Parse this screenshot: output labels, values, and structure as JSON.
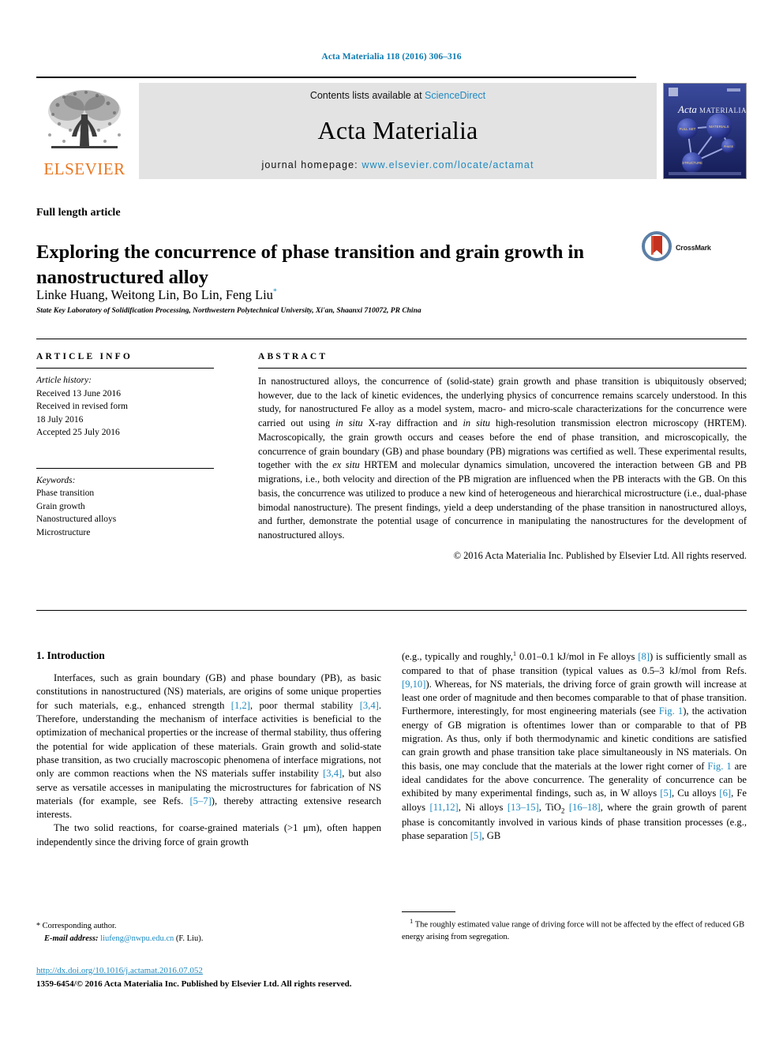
{
  "running_head": "Acta Materialia 118 (2016) 306–316",
  "masthead": {
    "publisher_name": "ELSEVIER",
    "publisher_logo_icon": "elsevier-tree-icon",
    "contents_prefix": "Contents lists available at",
    "contents_link": "ScienceDirect",
    "journal_title": "Acta Materialia",
    "homepage_prefix": "journal homepage:",
    "homepage_url": "www.elsevier.com/locate/actamat",
    "cover_title_italic": "Acta",
    "cover_title_rest": "MATERIALIA",
    "cover_icon": "journal-cover-thumbnail"
  },
  "article": {
    "type": "Full length article",
    "title": "Exploring the concurrence of phase transition and grain growth in nanostructured alloy",
    "authors": "Linke Huang, Weitong Lin, Bo Lin, Feng Liu",
    "corresponding_marker": "*",
    "affiliation": "State Key Laboratory of Solidification Processing, Northwestern Polytechnical University, Xi'an, Shaanxi 710072, PR China",
    "crossmark_label": "CrossMark",
    "crossmark_icon": "crossmark-icon"
  },
  "article_info": {
    "heading": "ARTICLE INFO",
    "history_label": "Article history:",
    "history": [
      "Received 13 June 2016",
      "Received in revised form",
      "18 July 2016",
      "Accepted 25 July 2016"
    ],
    "keywords_label": "Keywords:",
    "keywords": [
      "Phase transition",
      "Grain growth",
      "Nanostructured alloys",
      "Microstructure"
    ]
  },
  "abstract": {
    "heading": "ABSTRACT",
    "paragraph_1": "In nanostructured alloys, the concurrence of (solid-state) grain growth and phase transition is ubiquitously observed; however, due to the lack of kinetic evidences, the underlying physics of concurrence remains scarcely understood. In this study, for nanostructured Fe alloy as a model system, macro- and micro-scale characterizations for the concurrence were carried out using ",
    "italic_1": "in situ",
    "paragraph_2": " X-ray diffraction and ",
    "italic_2": "in situ",
    "paragraph_3": " high-resolution transmission electron microscopy (HRTEM). Macroscopically, the grain growth occurs and ceases before the end of phase transition, and microscopically, the concurrence of grain boundary (GB) and phase boundary (PB) migrations was certified as well. These experimental results, together with the ",
    "italic_3": "ex situ",
    "paragraph_4": " HRTEM and molecular dynamics simulation, uncovered the interaction between GB and PB migrations, i.e., both velocity and direction of the PB migration are influenced when the PB interacts with the GB. On this basis, the concurrence was utilized to produce a new kind of heterogeneous and hierarchical microstructure (i.e., dual-phase bimodal nanostructure). The present findings, yield a deep understanding of the phase transition in nanostructured alloys, and further, demonstrate the potential usage of concurrence in manipulating the nanostructures for the development of nanostructured alloys.",
    "copyright": "© 2016 Acta Materialia Inc. Published by Elsevier Ltd. All rights reserved."
  },
  "intro": {
    "heading": "1. Introduction",
    "left_para_1_a": "Interfaces, such as grain boundary (GB) and phase boundary (PB), as basic constitutions in nanostructured (NS) materials, are origins of some unique properties for such materials, e.g., enhanced strength ",
    "left_ref_1": "[1,2]",
    "left_para_1_b": ", poor thermal stability ",
    "left_ref_2": "[3,4]",
    "left_para_1_c": ". Therefore, understanding the mechanism of interface activities is beneficial to the optimization of mechanical properties or the increase of thermal stability, thus offering the potential for wide application of these materials. Grain growth and solid-state phase transition, as two crucially macroscopic phenomena of interface migrations, not only are common reactions when the NS materials suffer instability ",
    "left_ref_3": "[3,4]",
    "left_para_1_d": ", but also serve as versatile accesses in manipulating the microstructures for fabrication of NS materials (for example, see Refs. ",
    "left_ref_4": "[5–7]",
    "left_para_1_e": "), thereby attracting extensive research interests.",
    "left_para_2": "The two solid reactions, for coarse-grained materials (>1 μm), often happen independently since the driving force of grain growth",
    "right_a": "(e.g., typically and roughly,",
    "right_footnote_marker": "1",
    "right_b": " 0.01–0.1 kJ/mol in Fe alloys ",
    "right_ref_1": "[8]",
    "right_c": ") is sufficiently small as compared to that of phase transition (typical values as 0.5–3 kJ/mol from Refs. ",
    "right_ref_2": "[9,10]",
    "right_d": "). Whereas, for NS materials, the driving force of grain growth will increase at least one order of magnitude and then becomes comparable to that of phase transition. Furthermore, interestingly, for most engineering materials (see ",
    "right_ref_3": "Fig. 1",
    "right_e": "), the activation energy of GB migration is oftentimes lower than or comparable to that of PB migration. As thus, only if both thermodynamic and kinetic conditions are satisfied can grain growth and phase transition take place simultaneously in NS materials. On this basis, one may conclude that the materials at the lower right corner of ",
    "right_ref_4": "Fig. 1",
    "right_f": " are ideal candidates for the above concurrence. The generality of concurrence can be exhibited by many experimental findings, such as, in W alloys ",
    "right_ref_5": "[5]",
    "right_g": ", Cu alloys ",
    "right_ref_6": "[6]",
    "right_h": ", Fe alloys ",
    "right_ref_7": "[11,12]",
    "right_i": ", Ni alloys ",
    "right_ref_8": "[13–15]",
    "right_j": ", TiO",
    "right_j_sub": "2",
    "right_j_after": " ",
    "right_ref_9": "[16–18]",
    "right_k": ", where the grain growth of parent phase is concomitantly involved in various kinds of phase transition processes (e.g., phase separation ",
    "right_ref_10": "[5]",
    "right_l": ", GB"
  },
  "footers": {
    "corresponding_star": "*",
    "corresponding_text": "Corresponding author.",
    "email_label": "E-mail address:",
    "email_value": "liufeng@nwpu.edu.cn",
    "email_suffix": "(F. Liu).",
    "doi": "http://dx.doi.org/10.1016/j.actamat.2016.07.052",
    "issn_line": "1359-6454/© 2016 Acta Materialia Inc. Published by Elsevier Ltd. All rights reserved.",
    "footnote_marker": "1",
    "footnote_text": "The roughly estimated value range of driving force will not be affected by the effect of reduced GB energy arising from segregation."
  },
  "colors": {
    "link": "#1f8ac0",
    "running_head": "#0b7ab0",
    "elsevier_orange": "#e87722",
    "banner_bg": "#e3e3e3",
    "cover_bg": "#1a2a6e"
  }
}
